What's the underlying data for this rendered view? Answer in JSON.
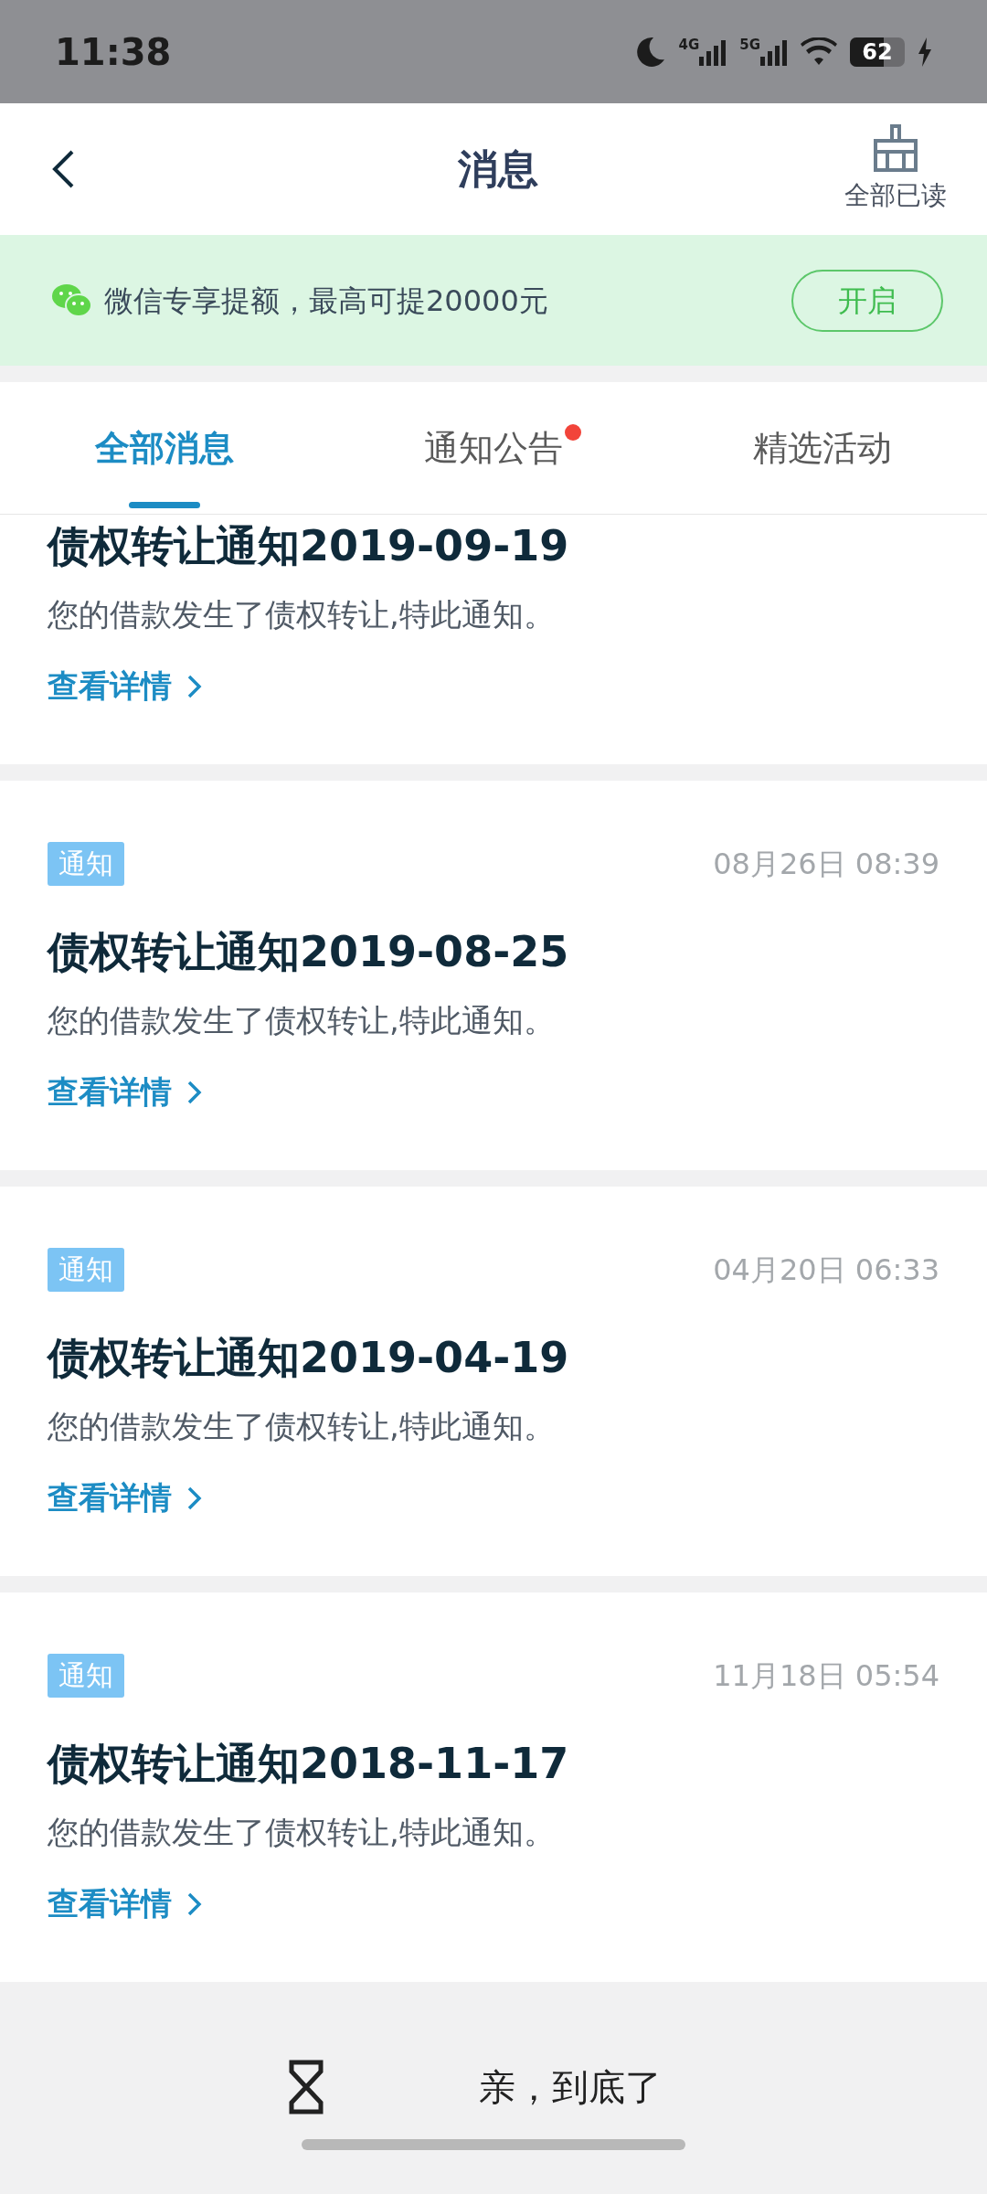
{
  "status_bar": {
    "time": "11:38",
    "network_1": "4G",
    "network_2": "5G",
    "battery": "62"
  },
  "header": {
    "title": "消息",
    "action_label": "全部已读"
  },
  "banner": {
    "text": "微信专享提额，最高可提20000元",
    "button": "开启"
  },
  "tabs": [
    {
      "label": "全部消息",
      "selected": true,
      "unread": false
    },
    {
      "label": "通知公告",
      "selected": false,
      "unread": true
    },
    {
      "label": "精选活动",
      "selected": false,
      "unread": false
    }
  ],
  "messages": [
    {
      "title": "债权转让通知2019-09-19",
      "body": "您的借款发生了债权转让,特此通知。",
      "link": "查看详情"
    },
    {
      "tag": "通知",
      "time": "08月26日 08:39",
      "title": "债权转让通知2019-08-25",
      "body": "您的借款发生了债权转让,特此通知。",
      "link": "查看详情"
    },
    {
      "tag": "通知",
      "time": "04月20日 06:33",
      "title": "债权转让通知2019-04-19",
      "body": "您的借款发生了债权转让,特此通知。",
      "link": "查看详情"
    },
    {
      "tag": "通知",
      "time": "11月18日 05:54",
      "title": "债权转让通知2018-11-17",
      "body": "您的借款发生了债权转让,特此通知。",
      "link": "查看详情"
    }
  ],
  "footer": {
    "text": "亲，到底了"
  }
}
